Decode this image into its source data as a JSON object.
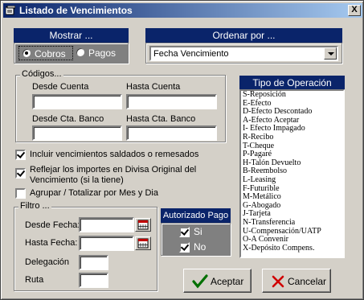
{
  "window": {
    "title": "Listado de  Vencimientos",
    "close_label": "X"
  },
  "mostrar": {
    "header": "Mostrar ...",
    "options": [
      "Cobros",
      "Pagos"
    ],
    "selected": "Cobros"
  },
  "ordenar": {
    "header": "Ordenar por ...",
    "selected": "Fecha Vencimiento"
  },
  "codigos": {
    "label": "Códigos...",
    "desde_cuenta": "Desde Cuenta",
    "hasta_cuenta": "Hasta Cuenta",
    "desde_banco": "Desde Cta. Banco",
    "hasta_banco": "Hasta Cta. Banco"
  },
  "options": {
    "incluir": "Incluir vencimientos saldados o remesados",
    "reflejar_1": "Reflejar los importes en Divisa Original del",
    "reflejar_2": "Vencimiento (si la tiene)",
    "agrupar": "Agrupar / Totalizar por Mes y  Dia",
    "incluir_checked": true,
    "reflejar_checked": true,
    "agrupar_checked": false
  },
  "filtro": {
    "label": "Filtro ...",
    "desde_fecha": "Desde Fecha:",
    "hasta_fecha": "Hasta Fecha:",
    "delegacion": "Delegación",
    "ruta": "Ruta"
  },
  "autorizado": {
    "header": "Autorizado Pago",
    "si": "Si",
    "no": "No",
    "si_checked": true,
    "no_checked": true
  },
  "tipo": {
    "header": "Tipo de Operación",
    "items": [
      "S-Reposición",
      "E-Efecto",
      "D-Efecto Descontado",
      "A-Efecto Aceptar",
      "I- Efecto Impagado",
      "R-Recibo",
      "T-Cheque",
      "P-Pagaré",
      "H-Talón Devuelto",
      "B-Reembolso",
      "L-Leasing",
      "F-Futurible",
      "M-Metálico",
      "G-Abogado",
      "J-Tarjeta",
      "N-Transferencia",
      "U-Compensación/UATP",
      "O-A Convenir",
      "X-Depósito Compens."
    ]
  },
  "buttons": {
    "aceptar": "Aceptar",
    "cancelar": "Cancelar"
  }
}
